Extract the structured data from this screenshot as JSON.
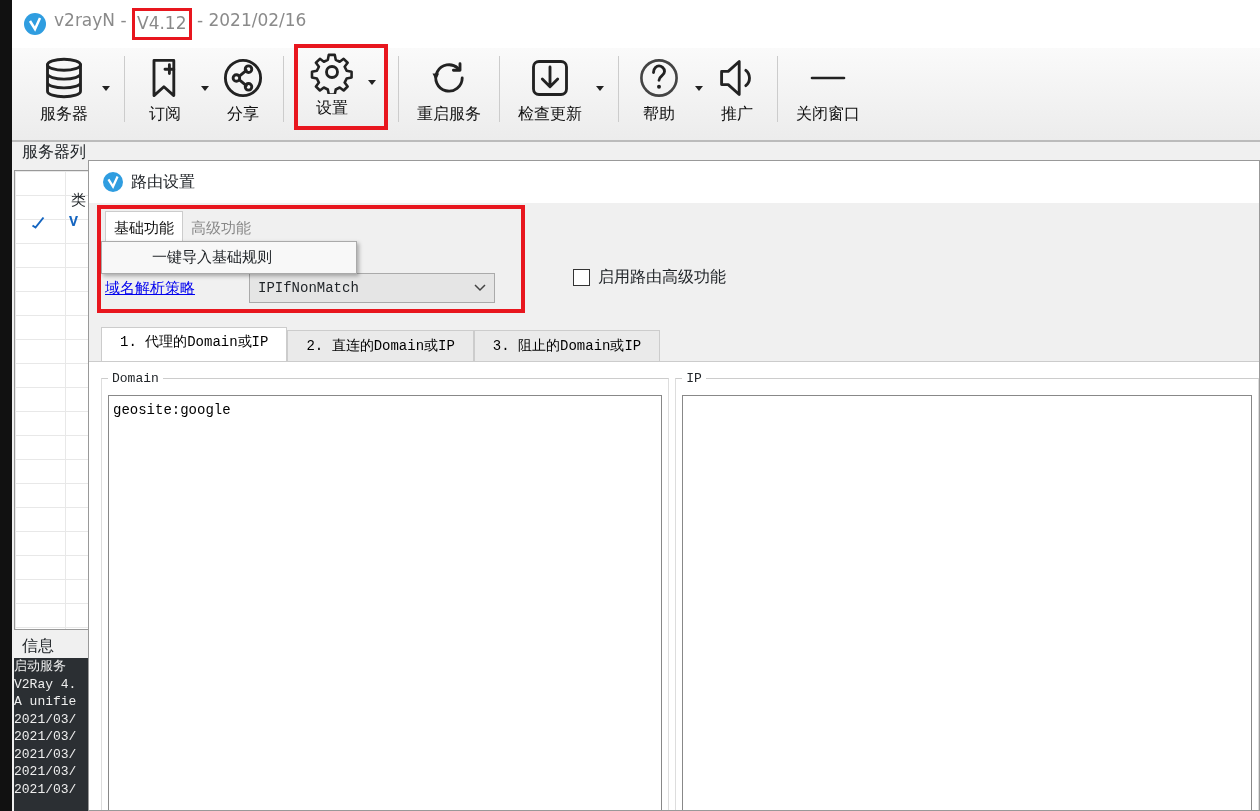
{
  "window": {
    "title_parts": [
      {
        "text": "v2rayN - ",
        "highlighted": false
      },
      {
        "text": "V4.12",
        "highlighted": true
      },
      {
        "text": " - 2021/02/16",
        "highlighted": false
      }
    ]
  },
  "toolbar": [
    {
      "label": "服务器",
      "dropdown": true,
      "separator_before": false,
      "highlighted": false
    },
    {
      "label": "订阅",
      "dropdown": true,
      "separator_before": true,
      "highlighted": false
    },
    {
      "label": "分享",
      "dropdown": false,
      "separator_before": false,
      "highlighted": false
    },
    {
      "label": "设置",
      "dropdown": true,
      "separator_before": true,
      "highlighted": true
    },
    {
      "label": "重启服务",
      "dropdown": false,
      "separator_before": true,
      "highlighted": false
    },
    {
      "label": "检查更新",
      "dropdown": true,
      "separator_before": true,
      "highlighted": false
    },
    {
      "label": "帮助",
      "dropdown": true,
      "separator_before": true,
      "highlighted": false
    },
    {
      "label": "推广",
      "dropdown": false,
      "separator_before": false,
      "highlighted": false
    },
    {
      "label": "关闭窗口",
      "dropdown": false,
      "separator_before": true,
      "highlighted": false
    }
  ],
  "server_list": {
    "title": "服务器列",
    "column_1": "类",
    "rows": [
      {
        "checked": true,
        "column_1": "V"
      }
    ]
  },
  "info": {
    "title": "信息",
    "log": [
      "启动服务",
      "V2Ray 4.",
      "A unifie",
      "2021/03/",
      "2021/03/",
      "2021/03/",
      "2021/03/",
      "2021/03/"
    ]
  },
  "dialog": {
    "title": "路由设置",
    "menu": {
      "highlighted": true,
      "items": [
        {
          "label": "基础功能",
          "selected": true
        },
        {
          "label": "高级功能",
          "selected": false
        }
      ],
      "dropdown": [
        "一键导入基础规则"
      ]
    },
    "strategy_link": "域名解析策略",
    "strategy_value": "IPIfNonMatch",
    "advanced_checkbox": {
      "label": "启用路由高级功能",
      "checked": false
    },
    "tabs": [
      {
        "label": "1. 代理的Domain或IP",
        "selected": true
      },
      {
        "label": "2. 直连的Domain或IP",
        "selected": false
      },
      {
        "label": "3. 阻止的Domain或IP",
        "selected": false
      }
    ],
    "domain": {
      "title": "Domain",
      "value": "geosite:google"
    },
    "ip": {
      "title": "IP"
    }
  }
}
